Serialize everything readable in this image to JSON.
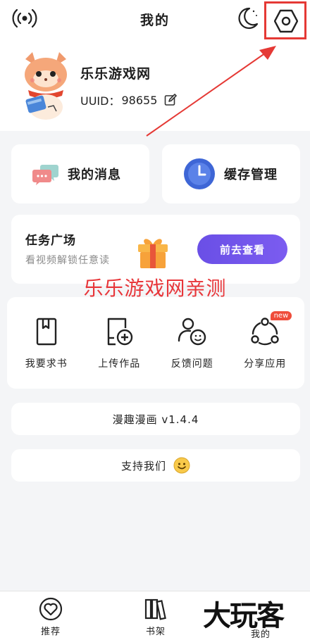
{
  "header": {
    "title": "我的"
  },
  "profile": {
    "username": "乐乐游戏网",
    "uuid_label": "UUID：",
    "uuid_value": "98655"
  },
  "cards": {
    "messages_label": "我的消息",
    "cache_label": "缓存管理"
  },
  "task": {
    "title": "任务广场",
    "subtitle": "看视频解锁任意读",
    "button": "前去查看"
  },
  "watermark": "乐乐游戏网亲测",
  "tools": [
    {
      "label": "我要求书",
      "icon": "book-icon"
    },
    {
      "label": "上传作品",
      "icon": "upload-add-icon"
    },
    {
      "label": "反馈问题",
      "icon": "feedback-user-icon"
    },
    {
      "label": "分享应用",
      "icon": "share-icon",
      "badge": "new"
    }
  ],
  "version": "漫趣漫画 v1.4.4",
  "support": "支持我们",
  "bottom_nav": [
    {
      "label": "推荐",
      "icon": "heart-circle-icon"
    },
    {
      "label": "书架",
      "icon": "bookshelf-icon"
    },
    {
      "label": "我的",
      "icon": "profile-icon"
    }
  ],
  "logo_text": "大玩客",
  "colors": {
    "accent_purple": "#7b5cf0",
    "highlight_red": "#e53935",
    "watermark_red": "#e8363a",
    "badge_red": "#ef4d3b"
  }
}
